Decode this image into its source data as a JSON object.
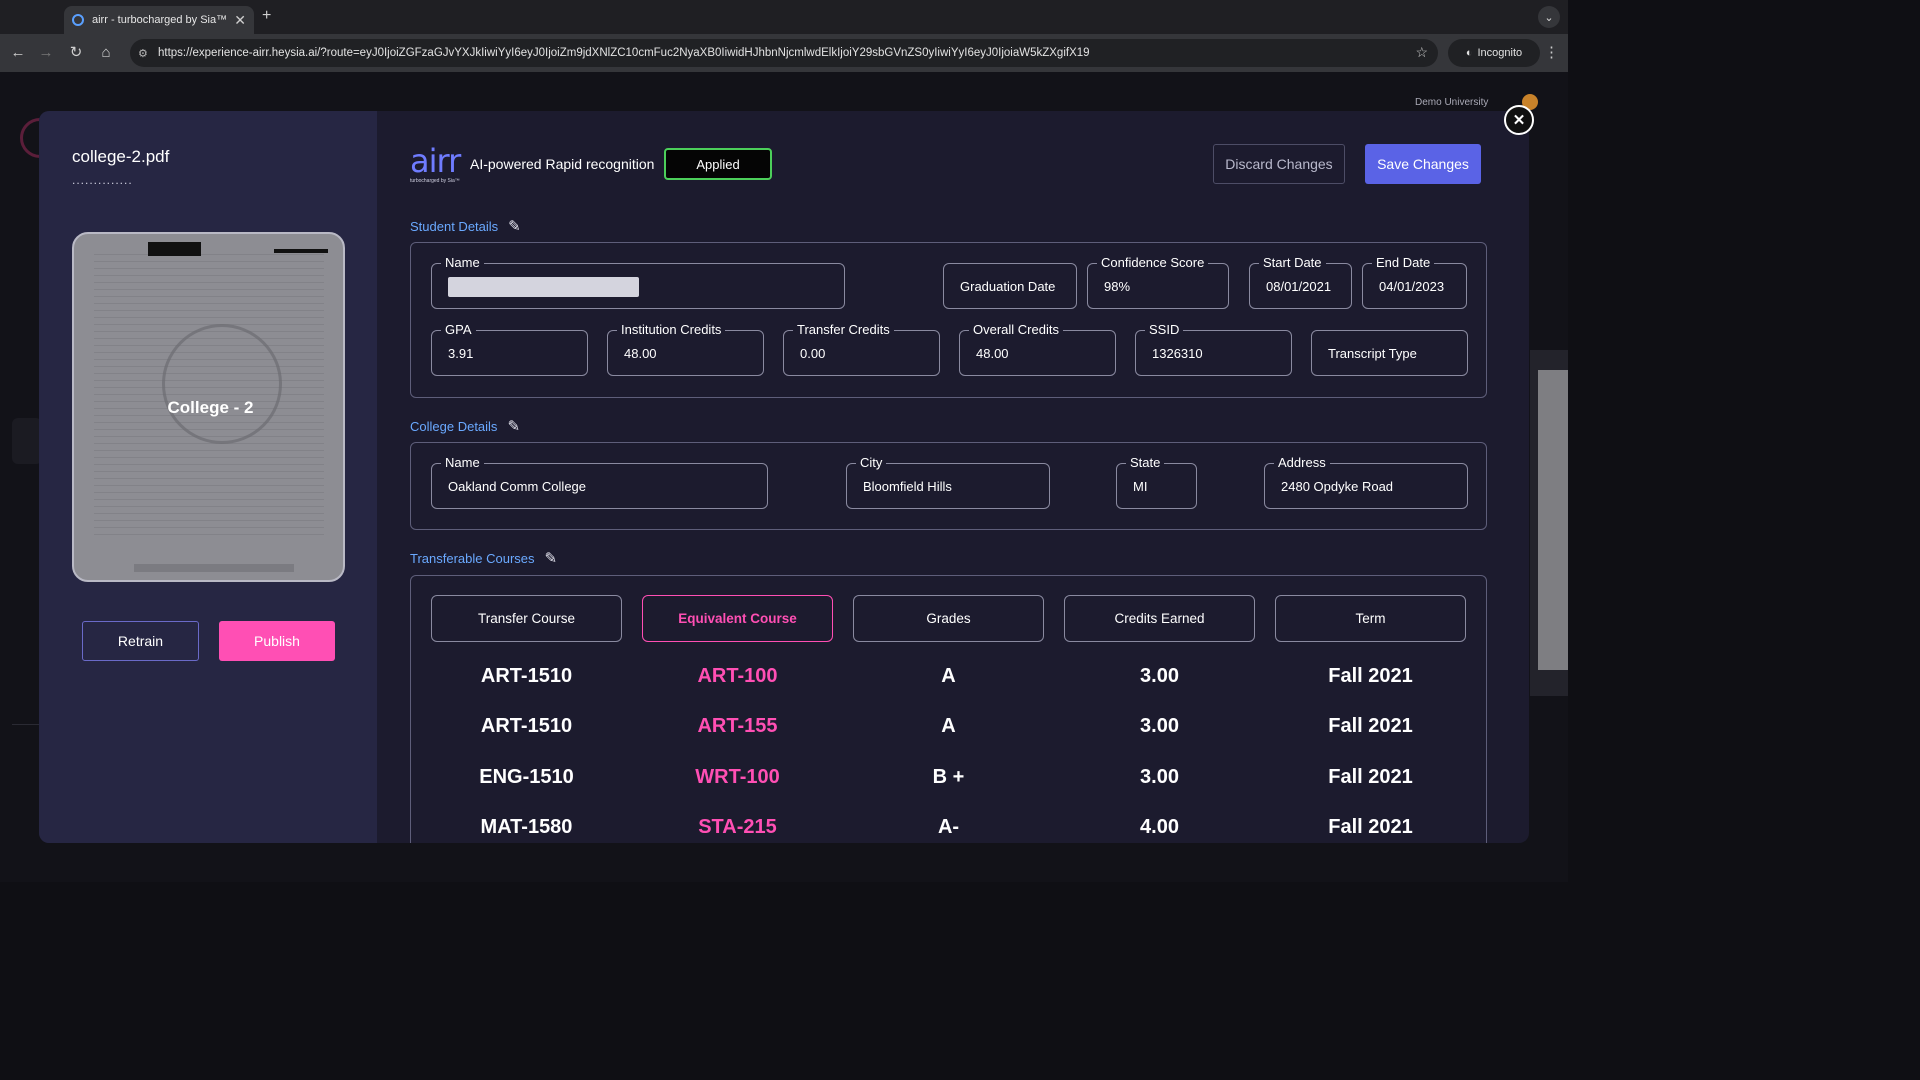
{
  "browser": {
    "tab_title": "airr - turbocharged by Sia™",
    "url": "https://experience-airr.heysia.ai/?route=eyJ0IjoiZGFzaGJvYXJkIiwiYyI6eyJ0IjoiZm9jdXNlZC10cmFuc2NyaXB0IiwidHJhbnNjcmlwdElkIjoiY29sbGVnZS0yIiwiYyI6eyJ0IjoiaW5kZXgifX19",
    "incognito_label": "Incognito"
  },
  "app": {
    "org_name": "Demo University"
  },
  "document": {
    "file_name": "college-2.pdf",
    "dots": "..............",
    "preview_label": "College - 2",
    "retrain_label": "Retrain",
    "publish_label": "Publish"
  },
  "header": {
    "logo_word": "airr",
    "logo_sub": "turbocharged by Sia™",
    "tagline": "AI-powered Rapid recognition",
    "status": "Applied",
    "discard_label": "Discard Changes",
    "save_label": "Save Changes"
  },
  "student": {
    "section_title": "Student Details",
    "name_label": "Name",
    "graduation_label": "Graduation Date",
    "confidence_label": "Confidence Score",
    "confidence_value": "98%",
    "start_label": "Start Date",
    "start_value": "08/01/2021",
    "end_label": "End Date",
    "end_value": "04/01/2023",
    "gpa_label": "GPA",
    "gpa_value": "3.91",
    "inst_credits_label": "Institution Credits",
    "inst_credits_value": "48.00",
    "transfer_credits_label": "Transfer Credits",
    "transfer_credits_value": "0.00",
    "overall_credits_label": "Overall Credits",
    "overall_credits_value": "48.00",
    "ssid_label": "SSID",
    "ssid_value": "1326310",
    "transcript_type_label": "Transcript Type"
  },
  "college": {
    "section_title": "College Details",
    "name_label": "Name",
    "name_value": "Oakland Comm College",
    "city_label": "City",
    "city_value": "Bloomfield Hills",
    "state_label": "State",
    "state_value": "MI",
    "address_label": "Address",
    "address_value": "2480 Opdyke Road"
  },
  "courses": {
    "section_title": "Transferable Courses",
    "headers": [
      "Transfer Course",
      "Equivalent Course",
      "Grades",
      "Credits Earned",
      "Term"
    ],
    "rows": [
      [
        "ART-1510",
        "ART-100",
        "A",
        "3.00",
        "Fall 2021"
      ],
      [
        "ART-1510",
        "ART-155",
        "A",
        "3.00",
        "Fall 2021"
      ],
      [
        "ENG-1510",
        "WRT-100",
        "B +",
        "3.00",
        "Fall 2021"
      ],
      [
        "MAT-1580",
        "STA-215",
        "A-",
        "4.00",
        "Fall 2021"
      ]
    ]
  },
  "colors": {
    "accent_pink": "#ff4fb4",
    "accent_blue": "#5a63e6",
    "link_blue": "#6aa9ff",
    "applied_green": "#4ccf5a"
  }
}
